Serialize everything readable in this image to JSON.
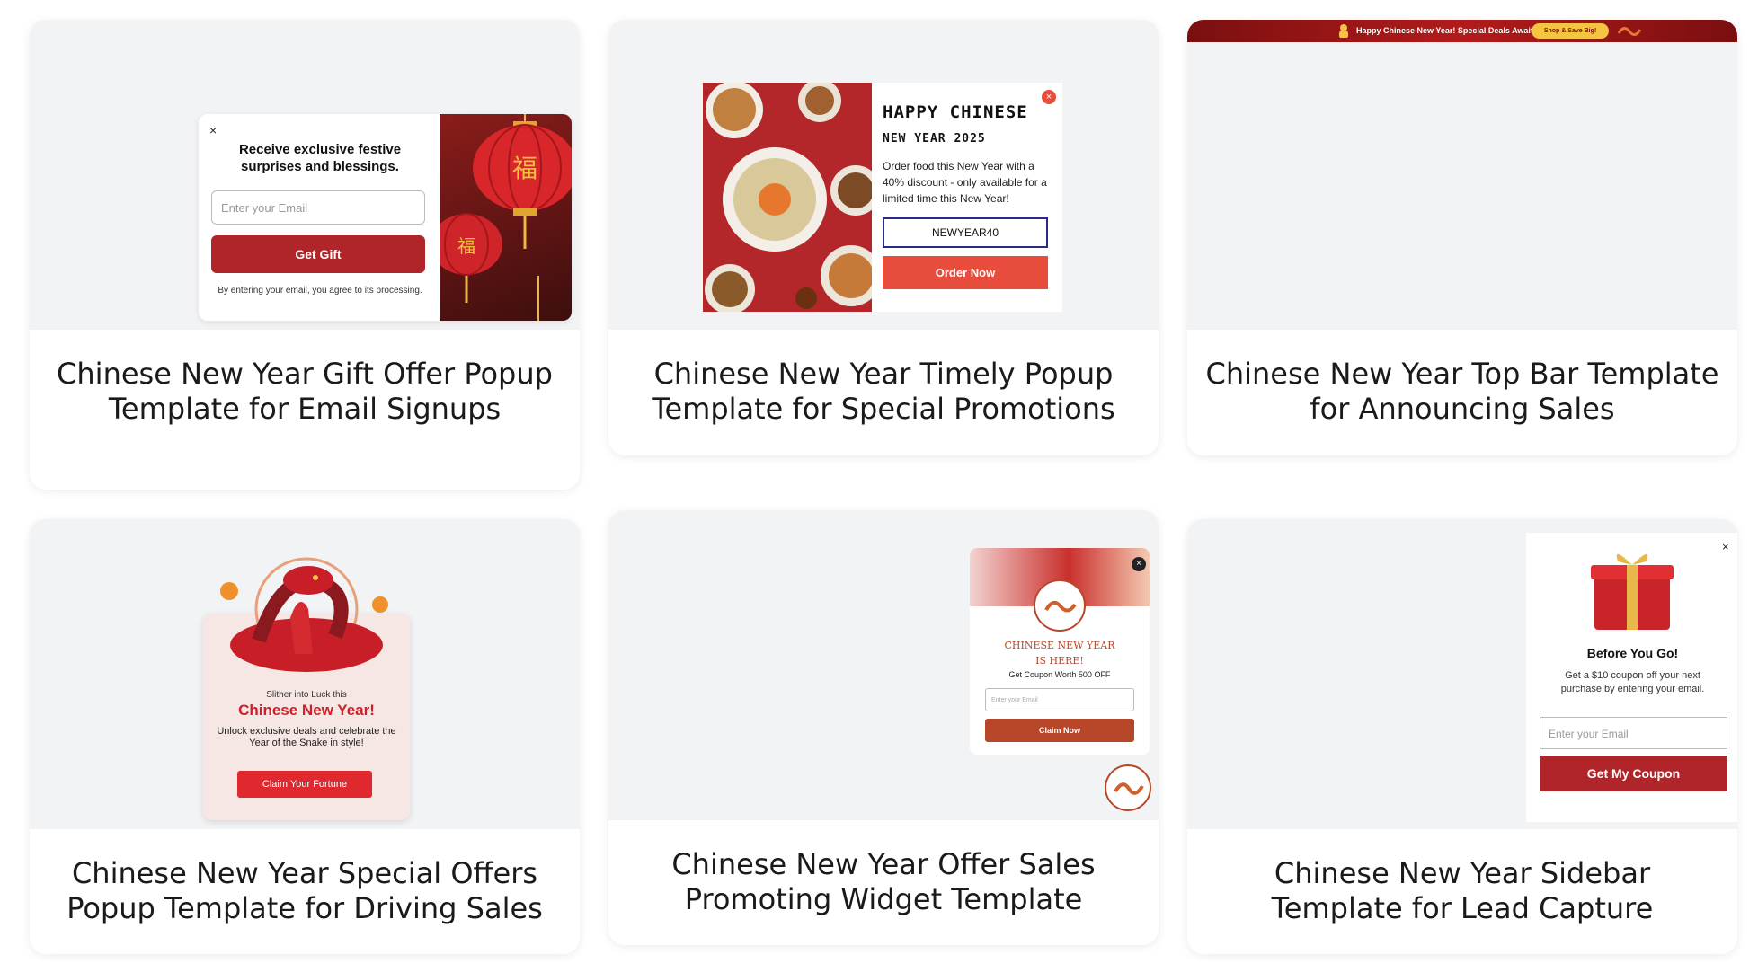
{
  "cards": [
    {
      "title": "Chinese New Year Gift Offer Popup Template for Email Signups",
      "popup": {
        "close": "×",
        "headline": "Receive exclusive festive surprises and blessings.",
        "email_placeholder": "Enter your Email",
        "button": "Get Gift",
        "note": "By entering your email, you agree to its processing."
      }
    },
    {
      "title": "Chinese New Year Timely Popup Template for Special Promotions",
      "popup": {
        "close": "×",
        "heading_line1": "HAPPY CHINESE",
        "heading_line2": "NEW YEAR  2025",
        "body": "Order food this New Year with a 40% discount - only available for a limited time this New Year!",
        "coupon_code": "NEWYEAR40",
        "button": "Order Now"
      }
    },
    {
      "title": "Chinese New Year Top Bar Template for Announcing Sales",
      "bar": {
        "text": "Happy Chinese New Year! Special Deals Await",
        "button": "Shop & Save Big!"
      }
    },
    {
      "title": "Chinese New Year Special Offers Popup Template for Driving Sales",
      "popup": {
        "subheading": "Slither into Luck this",
        "headline": "Chinese New Year!",
        "body": "Unlock exclusive deals and celebrate the Year of the Snake in style!",
        "button": "Claim Your Fortune"
      }
    },
    {
      "title": "Chinese New Year Offer Sales Promoting Widget Template",
      "widget": {
        "close": "×",
        "heading_line1": "CHINESE NEW YEAR",
        "heading_line2": "IS HERE!",
        "subheading": "Get Coupon Worth 500 OFF",
        "email_placeholder": "Enter your Email",
        "button": "Claim Now"
      }
    },
    {
      "title": "Chinese New Year Sidebar Template for Lead Capture",
      "sidebar": {
        "close": "×",
        "heading": "Before You Go!",
        "body": "Get a $10 coupon off your next purchase by entering your email.",
        "email_placeholder": "Enter your Email",
        "button": "Get My Coupon"
      }
    }
  ],
  "colors": {
    "card_preview_bg": "#f2f3f5",
    "brand_red": "#b0252a",
    "promo_red": "#e74c3c",
    "festive_red": "#d11e2a",
    "widget_rust": "#b8472a",
    "topbar_gold": "#f5c542"
  }
}
